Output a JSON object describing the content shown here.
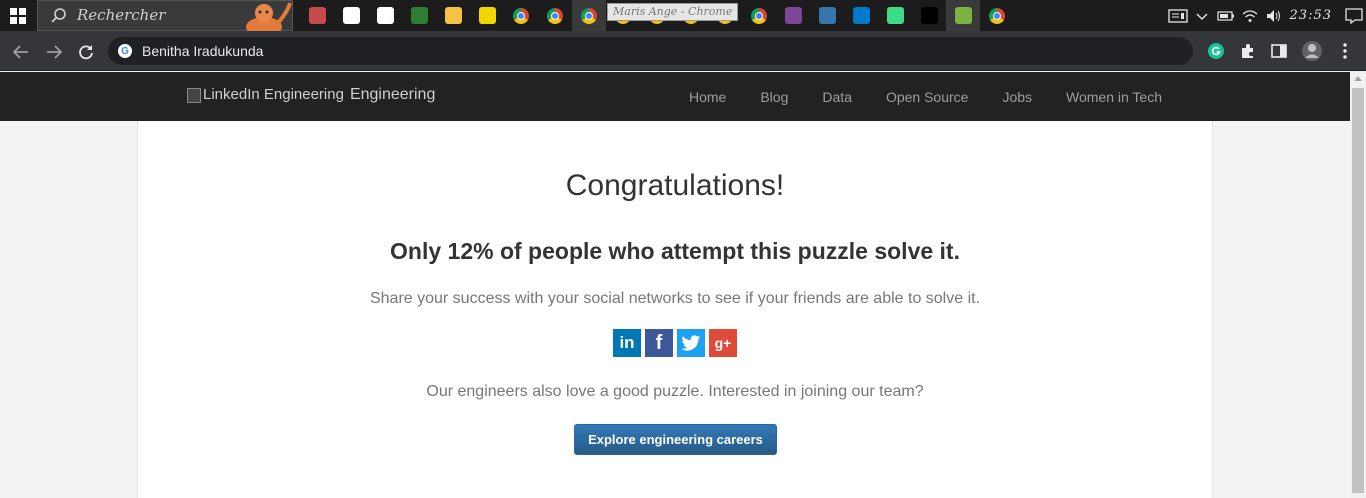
{
  "taskbar": {
    "search_placeholder": "Rechercher",
    "tooltip": "Maris Ange - Chrome",
    "clock": "23:53",
    "icons": [
      {
        "name": "photos-app-icon",
        "color": "#c94a4a"
      },
      {
        "name": "store-app-icon",
        "color": "#ffffff"
      },
      {
        "name": "notion-app-icon",
        "color": "#ffffff"
      },
      {
        "name": "maps-app-icon",
        "color": "#2e7d32"
      },
      {
        "name": "file-explorer-icon",
        "color": "#f5c343"
      },
      {
        "name": "media-player-icon",
        "color": "#f2d600"
      },
      {
        "name": "chrome-icon-1",
        "color": "#4285f4"
      },
      {
        "name": "chrome-icon-2",
        "color": "#4285f4"
      },
      {
        "name": "chrome-icon-3",
        "color": "#4285f4"
      },
      {
        "name": "chrome-icon-4",
        "color": "#4285f4"
      },
      {
        "name": "chrome-icon-5",
        "color": "#4285f4"
      },
      {
        "name": "chrome-icon-6",
        "color": "#4285f4"
      },
      {
        "name": "chrome-icon-7",
        "color": "#4285f4"
      },
      {
        "name": "chrome-icon-8",
        "color": "#4285f4"
      },
      {
        "name": "tor-browser-icon",
        "color": "#7d4698"
      },
      {
        "name": "python-idle-icon",
        "color": "#3776ab"
      },
      {
        "name": "vscode-icon",
        "color": "#007acc"
      },
      {
        "name": "android-studio-icon",
        "color": "#3ddc84"
      },
      {
        "name": "pycharm-icon",
        "color": "#000000"
      },
      {
        "name": "bluestacks-icon",
        "color": "#7cb342"
      },
      {
        "name": "chrome-icon-9",
        "color": "#4285f4"
      }
    ]
  },
  "browser": {
    "address": "Benitha Iradukunda"
  },
  "site": {
    "logo_alt": "LinkedIn Engineering",
    "brand": "Engineering",
    "nav": [
      "Home",
      "Blog",
      "Data",
      "Open Source",
      "Jobs",
      "Women in Tech"
    ]
  },
  "main": {
    "title": "Congratulations!",
    "subtitle": "Only 12% of people who attempt this puzzle solve it.",
    "share_text": "Share your success with your social networks to see if your friends are able to solve it.",
    "social": [
      {
        "name": "linkedin",
        "glyph": "in",
        "color": "#0077b5"
      },
      {
        "name": "facebook",
        "glyph": "f",
        "color": "#3b5998"
      },
      {
        "name": "twitter",
        "glyph": "",
        "color": "#1da1f2"
      },
      {
        "name": "google-plus",
        "glyph": "g+",
        "color": "#dd4b39"
      }
    ],
    "join_text": "Our engineers also love a good puzzle. Interested in joining our team?",
    "cta_label": "Explore engineering careers"
  }
}
